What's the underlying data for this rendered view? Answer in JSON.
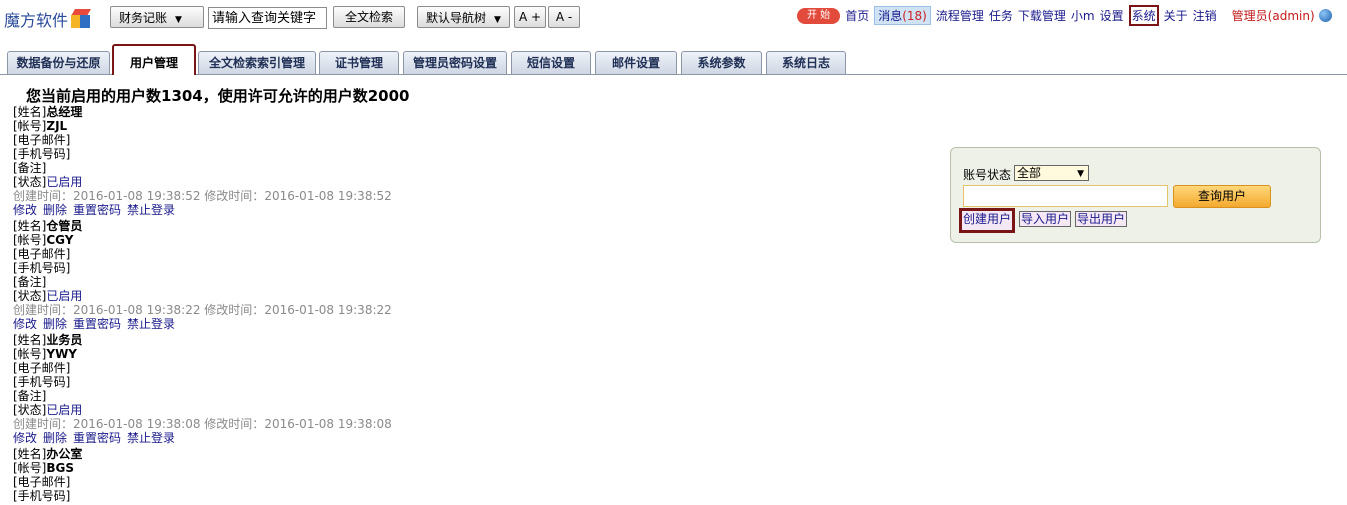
{
  "app": {
    "logo_text": "魔方软件"
  },
  "toolbar": {
    "module_select": "财务记账",
    "search_placeholder": "请输入查询关键字",
    "fulltext_button": "全文检索",
    "nav_tree_select": "默认导航树",
    "font_increase": "A +",
    "font_decrease": "A -"
  },
  "topnav": {
    "start": "开 始",
    "home": "首页",
    "messages_label": "消息",
    "messages_count": "(18)",
    "workflow": "流程管理",
    "tasks": "任务",
    "downloads": "下载管理",
    "xiaom": "小m",
    "settings": "设置",
    "system": "系统",
    "about": "关于",
    "logout": "注销",
    "user": "管理员(admin)"
  },
  "tabs": [
    {
      "label": "数据备份与还原"
    },
    {
      "label": "用户管理"
    },
    {
      "label": "全文检索索引管理"
    },
    {
      "label": "证书管理"
    },
    {
      "label": "管理员密码设置"
    },
    {
      "label": "短信设置"
    },
    {
      "label": "邮件设置"
    },
    {
      "label": "系统参数"
    },
    {
      "label": "系统日志"
    }
  ],
  "summary": "您当前启用的用户数1304，使用许可允许的用户数2000",
  "labels": {
    "name": "[姓名]",
    "account": "[帐号]",
    "email": "[电子邮件]",
    "phone": "[手机号码]",
    "note": "[备注]",
    "status": "[状态]",
    "created": "创建时间：",
    "modified": "修改时间：",
    "edit": "修改",
    "delete": "删除",
    "reset_password": "重置密码",
    "ban_login": "禁止登录"
  },
  "users": [
    {
      "name": "总经理",
      "account": "ZJL",
      "status": "已启用",
      "created": "2016-01-08 19:38:52",
      "modified": "2016-01-08 19:38:52"
    },
    {
      "name": "仓管员",
      "account": "CGY",
      "status": "已启用",
      "created": "2016-01-08 19:38:22",
      "modified": "2016-01-08 19:38:22"
    },
    {
      "name": "业务员",
      "account": "YWY",
      "status": "已启用",
      "created": "2016-01-08 19:38:08",
      "modified": "2016-01-08 19:38:08"
    },
    {
      "name": "办公室",
      "account": "BGS"
    }
  ],
  "query_panel": {
    "status_label": "账号状态",
    "status_value": "全部",
    "query_button": "查询用户",
    "create_button": "创建用户",
    "import_button": "导入用户",
    "export_button": "导出用户"
  }
}
